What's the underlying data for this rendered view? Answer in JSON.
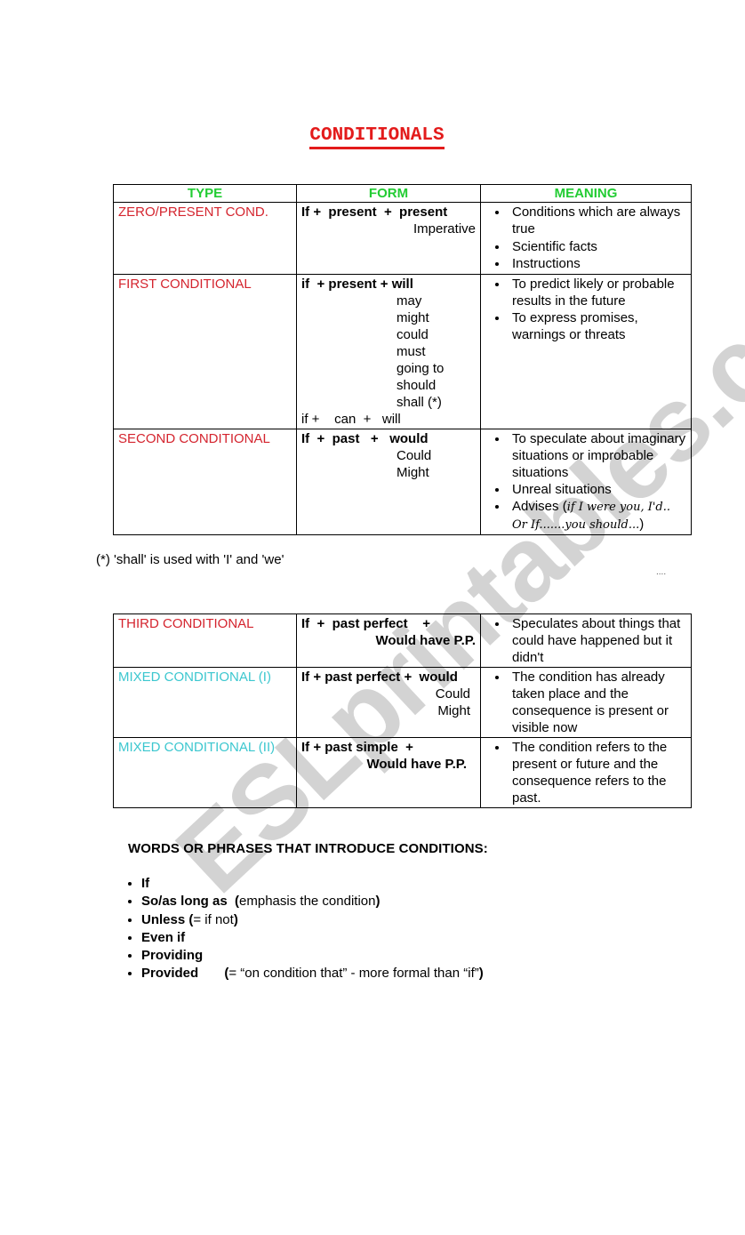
{
  "title": "CONDITIONALS",
  "table1": {
    "headers": [
      "TYPE",
      "FORM",
      "MEANING"
    ],
    "rows": [
      {
        "type": "ZERO/PRESENT COND.",
        "form_main": "If +  present  +  present",
        "form_sub": [
          "Imperative"
        ],
        "meaning": [
          "Conditions which are always true",
          "Scientific facts",
          "Instructions"
        ]
      },
      {
        "type": "FIRST CONDITIONAL",
        "form_main": "if  + present + will",
        "form_sub": [
          "may",
          "might",
          "could",
          "must",
          "going to",
          "should",
          "shall (*)"
        ],
        "form_extra": "if +    can  +   will",
        "meaning": [
          "To predict likely or probable results in the future",
          "To express promises, warnings or threats"
        ]
      },
      {
        "type": "SECOND CONDITIONAL",
        "form_main": "If  +  past   +   would",
        "form_sub": [
          "Could",
          "Might"
        ],
        "meaning": [
          "To speculate about imaginary situations or improbable situations",
          "Unreal situations"
        ],
        "meaning_advise": {
          "label": "Advises (",
          "example": "if I were you, I'd.. Or If.......you should...",
          "close": ")"
        }
      }
    ]
  },
  "footnote": "(*) 'shall' is used with 'I' and 'we'",
  "dots": "....",
  "table2": {
    "rows": [
      {
        "type": "THIRD CONDITIONAL",
        "form_main": "If  +  past perfect    +",
        "form_second": "Would have P.P.",
        "meaning": [
          "Speculates about things that could have happened but it didn't"
        ]
      },
      {
        "type": "MIXED CONDITIONAL (I)",
        "form_main": "If + past perfect +  would",
        "form_sub": [
          "Could",
          "Might"
        ],
        "meaning": [
          "The condition has already taken place and the consequence is present or visible now"
        ]
      },
      {
        "type": "MIXED CONDITIONAL (II)",
        "form_main": "If + past simple  +",
        "form_second": "Would have P.P.",
        "meaning": [
          "The condition refers to the present or future and the consequence refers to the past."
        ]
      }
    ]
  },
  "words": {
    "heading": "WORDS OR PHRASES THAT INTRODUCE CONDITIONS:",
    "items": [
      {
        "bold": "If",
        "rest": ""
      },
      {
        "bold": "So/as long as  (",
        "rest": "emphasis the condition",
        "close": ")"
      },
      {
        "bold": "Unless (",
        "rest": "= if not",
        "close": ")"
      },
      {
        "bold": "Even if",
        "rest": ""
      },
      {
        "bold": "Providing",
        "rest": ""
      },
      {
        "bold": "Provided       (",
        "rest": "= “on condition that” -  more formal than “if”",
        "close": ")"
      }
    ]
  },
  "watermark": "ESLprintables.com",
  "colors": {
    "title": "#e31b1b",
    "header": "#22cc33",
    "type_red": "#d4242e",
    "type_cyan": "#3cc7cf"
  }
}
